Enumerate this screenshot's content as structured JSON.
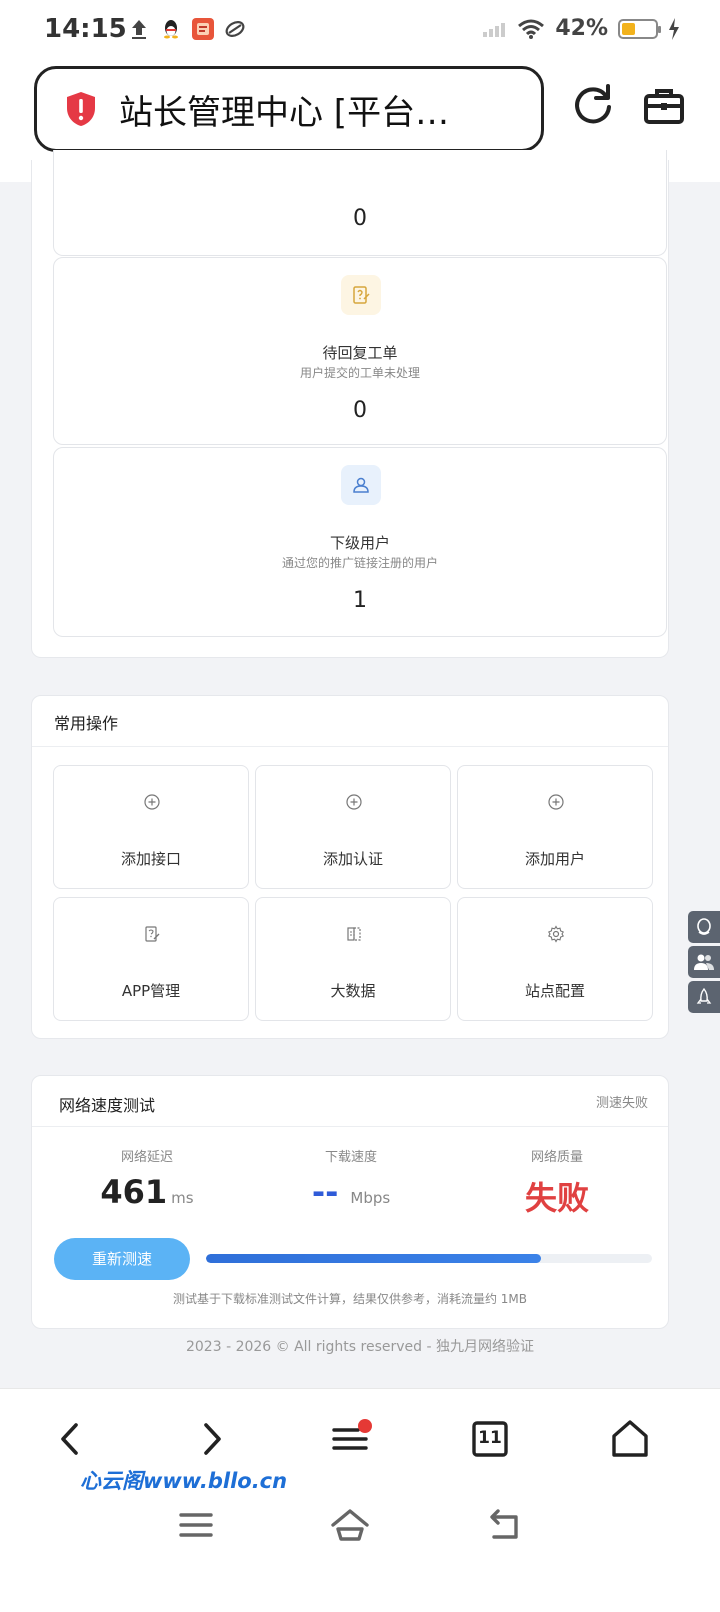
{
  "status_bar": {
    "time": "14:15",
    "battery_percent": "42%",
    "battery_level": 0.42,
    "notification_icons": [
      "upload-icon",
      "qq-icon",
      "app-icon",
      "link-icon"
    ]
  },
  "address_bar": {
    "title": "站长管理中心 [平台…"
  },
  "stats": {
    "items": [
      {
        "title": "",
        "desc": "",
        "value": "0",
        "icon": "ticket-icon"
      },
      {
        "title": "待回复工单",
        "desc": "用户提交的工单未处理",
        "value": "0",
        "icon": "ticket-icon"
      },
      {
        "title": "下级用户",
        "desc": "通过您的推广链接注册的用户",
        "value": "1",
        "icon": "user-icon"
      }
    ]
  },
  "quick_actions": {
    "title": "常用操作",
    "items": [
      {
        "label": "添加接口",
        "icon": "plus-circle-icon"
      },
      {
        "label": "添加认证",
        "icon": "plus-circle-icon"
      },
      {
        "label": "添加用户",
        "icon": "plus-circle-icon"
      },
      {
        "label": "APP管理",
        "icon": "edit-doc-icon"
      },
      {
        "label": "大数据",
        "icon": "data-icon"
      },
      {
        "label": "站点配置",
        "icon": "gear-icon"
      }
    ]
  },
  "speed_test": {
    "title": "网络速度测试",
    "status": "测速失败",
    "latency_label": "网络延迟",
    "latency_value": "461",
    "latency_unit": "ms",
    "download_label": "下载速度",
    "download_value": "--",
    "download_unit": "Mbps",
    "quality_label": "网络质量",
    "quality_value": "失败",
    "retest_label": "重新测速",
    "progress": 0.75,
    "note": "测试基于下载标准测试文件计算，结果仅供参考，消耗流量约 1MB",
    "colors": {
      "fail": "#e04141",
      "download": "#2f5bd8"
    }
  },
  "footer": {
    "text": "2023 - 2026 © All rights reserved - 独九月网络验证"
  },
  "bottom_bar": {
    "tab_count": "11",
    "watermark": "心云阁www.bllo.cn"
  }
}
